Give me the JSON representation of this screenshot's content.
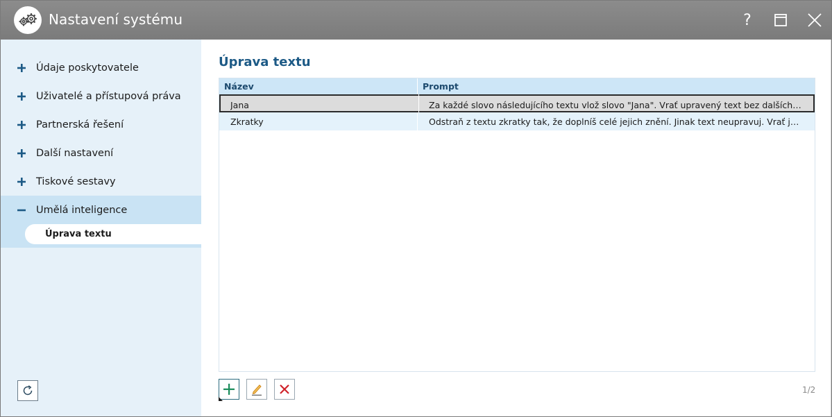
{
  "window": {
    "title": "Nastavení systému",
    "help_label": "?",
    "icons": {
      "logo": "gears-icon",
      "help": "help-icon",
      "maximize": "maximize-icon",
      "close": "close-icon"
    }
  },
  "sidebar": {
    "items": [
      {
        "label": "Údaje poskytovatele",
        "expanded": false
      },
      {
        "label": "Uživatelé a přístupová práva",
        "expanded": false
      },
      {
        "label": "Partnerská řešení",
        "expanded": false
      },
      {
        "label": "Další nastavení",
        "expanded": false
      },
      {
        "label": "Tiskové sestavy",
        "expanded": false
      },
      {
        "label": "Umělá inteligence",
        "expanded": true
      }
    ],
    "subitem": {
      "label": "Úprava textu"
    },
    "refresh_icon": "refresh-icon"
  },
  "main": {
    "title": "Úprava textu",
    "columns": {
      "name": "Název",
      "prompt": "Prompt"
    },
    "rows": [
      {
        "name": "Jana",
        "prompt": "Za každé slovo následujícího textu vlož slovo \"Jana\". Vrať upravený text bez dalších poznámek."
      },
      {
        "name": "Zkratky",
        "prompt": "Odstraň z textu zkratky tak, že doplníš celé jejich znění. Jinak text neupravuj. Vrať jej bez vysvětlení."
      }
    ],
    "pager": "1/2",
    "buttons": {
      "add_icon": "plus-icon",
      "edit_icon": "pencil-icon",
      "delete_icon": "delete-icon"
    }
  },
  "colors": {
    "titlebar": "#808080",
    "sidebar_bg": "#e6f1f9",
    "sidebar_active": "#c9e3f4",
    "accent_blue": "#1d5a86",
    "add_green": "#1a8c5a",
    "delete_red": "#d0222a",
    "edit_orange": "#e8a23a"
  }
}
